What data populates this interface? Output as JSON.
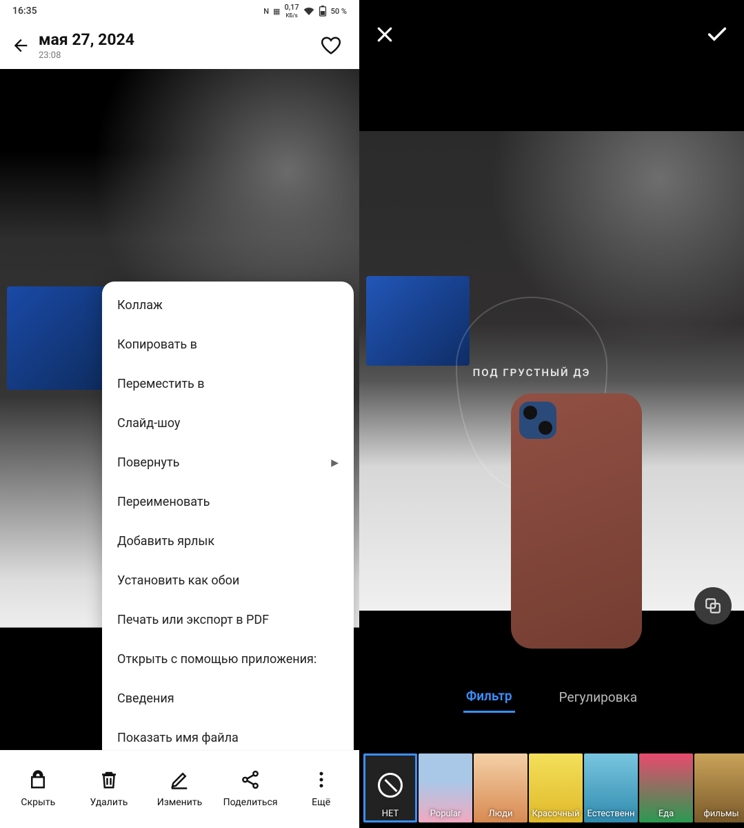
{
  "statusbar": {
    "time": "16:35",
    "net_speed": "0,17",
    "net_unit": "КБ/s",
    "battery": "50 %"
  },
  "left": {
    "date": "мая 27, 2024",
    "time": "23:08",
    "menu": [
      {
        "label": "Коллаж",
        "has_submenu": false
      },
      {
        "label": "Копировать в",
        "has_submenu": false
      },
      {
        "label": "Переместить в",
        "has_submenu": false
      },
      {
        "label": "Слайд-шоу",
        "has_submenu": false
      },
      {
        "label": "Повернуть",
        "has_submenu": true
      },
      {
        "label": "Переименовать",
        "has_submenu": false
      },
      {
        "label": "Добавить ярлык",
        "has_submenu": false
      },
      {
        "label": "Установить как обои",
        "has_submenu": false
      },
      {
        "label": "Печать или экспорт в PDF",
        "has_submenu": false
      },
      {
        "label": "Открыть с помощью приложения:",
        "has_submenu": false
      },
      {
        "label": "Сведения",
        "has_submenu": false
      },
      {
        "label": "Показать имя файла",
        "has_submenu": false
      }
    ],
    "actions": {
      "hide": "Скрыть",
      "delete": "Удалить",
      "edit": "Изменить",
      "share": "Поделиться",
      "more": "Ещё"
    }
  },
  "right": {
    "glass_text": "ПОД ГРУСТНЫЙ ДЭ",
    "tabs": {
      "filter": "Фильтр",
      "adjust": "Регулировка"
    },
    "filters": [
      {
        "label": "НЕТ",
        "selected": true,
        "cls": "f-none"
      },
      {
        "label": "Popular",
        "selected": false,
        "cls": "f-pop"
      },
      {
        "label": "Люди",
        "selected": false,
        "cls": "f-ppl"
      },
      {
        "label": "Красочный",
        "selected": false,
        "cls": "f-red"
      },
      {
        "label": "Естественн",
        "selected": false,
        "cls": "f-nat"
      },
      {
        "label": "Еда",
        "selected": false,
        "cls": "f-food"
      },
      {
        "label": "фильмы",
        "selected": false,
        "cls": "f-film"
      },
      {
        "label": "",
        "selected": false,
        "cls": "f-extra"
      }
    ]
  }
}
